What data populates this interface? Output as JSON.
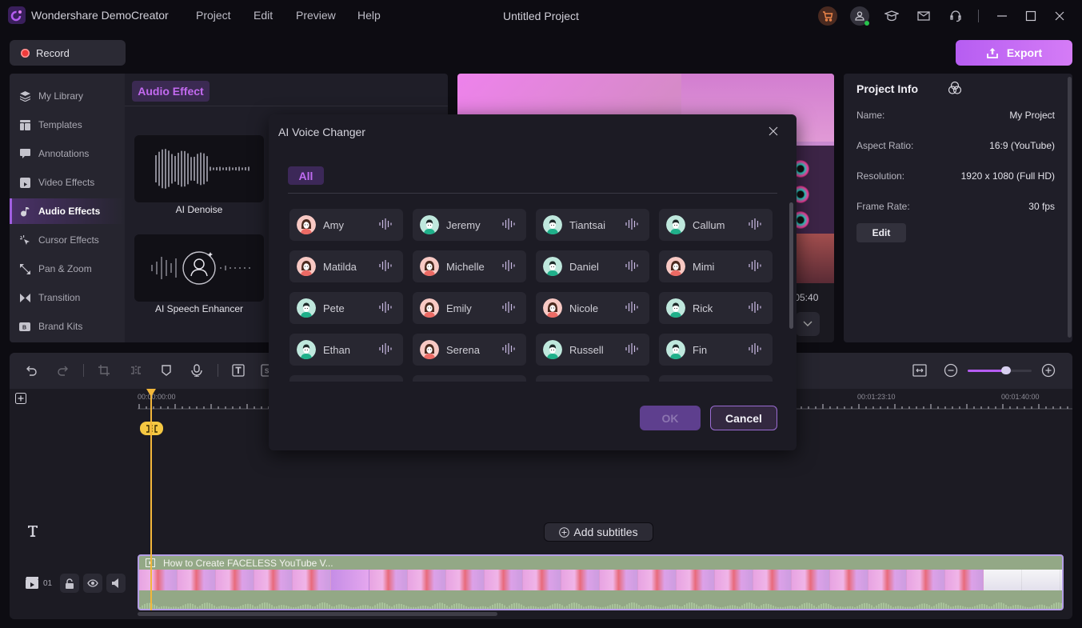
{
  "app": {
    "name": "Wondershare DemoCreator",
    "project_title": "Untitled Project",
    "menu": [
      "Project",
      "Edit",
      "Preview",
      "Help"
    ],
    "title_icons": [
      "cart-icon",
      "account-icon",
      "graduation-cap-icon",
      "mail-icon",
      "support-headset-icon",
      "minimize-icon",
      "maximize-icon",
      "close-icon"
    ]
  },
  "toolbar": {
    "record_label": "Record",
    "export_label": "Export"
  },
  "sidebar": {
    "items": [
      {
        "label": "My Library",
        "icon": "layers-icon"
      },
      {
        "label": "Templates",
        "icon": "template-icon"
      },
      {
        "label": "Annotations",
        "icon": "annotation-icon"
      },
      {
        "label": "Video Effects",
        "icon": "video-effects-icon"
      },
      {
        "label": "Audio Effects",
        "icon": "music-note-icon",
        "active": true
      },
      {
        "label": "Cursor Effects",
        "icon": "cursor-click-icon"
      },
      {
        "label": "Pan & Zoom",
        "icon": "pan-zoom-icon"
      },
      {
        "label": "Transition",
        "icon": "transition-icon"
      },
      {
        "label": "Brand Kits",
        "icon": "brand-kit-icon"
      }
    ]
  },
  "effects_panel": {
    "tab": "Audio Effect",
    "items": [
      {
        "label": "AI Denoise"
      },
      {
        "label": "AI Speech Enhancer"
      }
    ]
  },
  "preview": {
    "time_readout": ":05:40"
  },
  "project_info": {
    "title": "Project Info",
    "rows": [
      {
        "key": "Name:",
        "value": "My Project"
      },
      {
        "key": "Aspect Ratio:",
        "value": "16:9 (YouTube)"
      },
      {
        "key": "Resolution:",
        "value": "1920 x 1080 (Full HD)"
      },
      {
        "key": "Frame Rate:",
        "value": "30 fps"
      }
    ],
    "edit_label": "Edit"
  },
  "modal": {
    "title": "AI Voice Changer",
    "tab_all": "All",
    "voices": [
      {
        "name": "Amy",
        "gender": "female"
      },
      {
        "name": "Jeremy",
        "gender": "male"
      },
      {
        "name": "Tiantsai",
        "gender": "male"
      },
      {
        "name": "Callum",
        "gender": "male"
      },
      {
        "name": "Matilda",
        "gender": "female"
      },
      {
        "name": "Michelle",
        "gender": "female"
      },
      {
        "name": "Daniel",
        "gender": "male"
      },
      {
        "name": "Mimi",
        "gender": "female"
      },
      {
        "name": "Pete",
        "gender": "male"
      },
      {
        "name": "Emily",
        "gender": "female"
      },
      {
        "name": "Nicole",
        "gender": "female"
      },
      {
        "name": "Rick",
        "gender": "male"
      },
      {
        "name": "Ethan",
        "gender": "male"
      },
      {
        "name": "Serena",
        "gender": "female"
      },
      {
        "name": "Russell",
        "gender": "male"
      },
      {
        "name": "Fin",
        "gender": "male"
      }
    ],
    "ok_label": "OK",
    "cancel_label": "Cancel"
  },
  "timeline": {
    "ruler_labels": [
      "00:00:00:00",
      "00:01:23:10",
      "00:01:40:00"
    ],
    "zoom_level": 0.6,
    "add_subtitles_label": "Add subtitles",
    "track_number": "01",
    "clip_title": "How to Create FACELESS YouTube V..."
  },
  "colors": {
    "accent": "#b65df2",
    "playhead": "#f2b63a",
    "clip_bg": "#93a886",
    "clip_border": "#b49ee6"
  }
}
